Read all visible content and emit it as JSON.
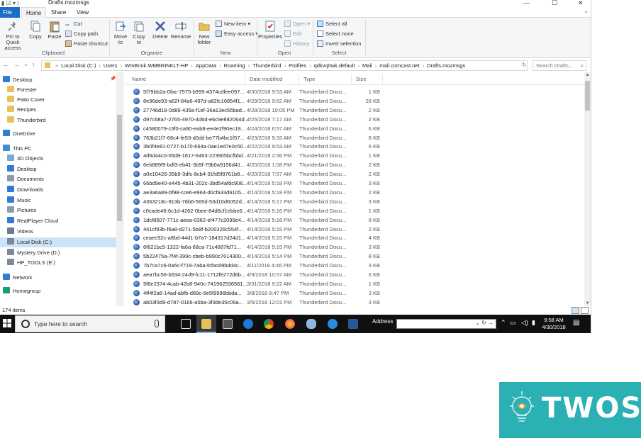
{
  "window": {
    "title": "Drafts.mozmsgs",
    "controls": [
      "—",
      "☐",
      "✕"
    ],
    "help_icon": "chevron-down-icon"
  },
  "ribbon": {
    "tabs": [
      "File",
      "Home",
      "Share",
      "View"
    ],
    "active_tab": "Home",
    "clipboard": {
      "pin": "Pin to Quick access",
      "copy": "Copy",
      "paste": "Paste",
      "cut": "Cut",
      "copy_path": "Copy path",
      "paste_shortcut": "Paste shortcut",
      "group": "Clipboard"
    },
    "organize": {
      "move_to": "Move to",
      "copy_to": "Copy to",
      "delete": "Delete",
      "rename": "Rename",
      "group": "Organize"
    },
    "new": {
      "new_folder": "New folder",
      "new_item": "New item",
      "easy_access": "Easy access",
      "group": "New"
    },
    "open": {
      "properties": "Properties",
      "open": "Open",
      "edit": "Edit",
      "history": "History",
      "group": "Open"
    },
    "select": {
      "select_all": "Select all",
      "select_none": "Select none",
      "invert": "Invert selection",
      "group": "Select"
    }
  },
  "address": {
    "back": "←",
    "forward": "→",
    "recent": "⌄",
    "up": "↑",
    "overflow": "«",
    "path": [
      "Local Disk (C:)",
      "Users",
      "WmBrink.WMBRINKLT-HP",
      "AppData",
      "Roaming",
      "Thunderbird",
      "Profiles",
      "qdkvq0wk.default",
      "Mail",
      "mail.comcast.net",
      "Drafts.mozmsgs"
    ],
    "search_placeholder": "Search Drafts..."
  },
  "nav_pane": [
    {
      "label": "Desktop",
      "icon": "desktop-icon",
      "color": "#2f7bd6"
    },
    {
      "label": "Forester",
      "icon": "folder-icon",
      "color": "#e8c15a"
    },
    {
      "label": "Patio Cover",
      "icon": "folder-icon",
      "color": "#e8c15a"
    },
    {
      "label": "Recipes",
      "icon": "folder-icon",
      "color": "#e8c15a"
    },
    {
      "label": "Thunderbird",
      "icon": "folder-icon",
      "color": "#e8c15a"
    },
    {
      "label": "OneDrive",
      "icon": "cloud-icon",
      "color": "#2f7bd6"
    },
    {
      "label": "This PC",
      "icon": "computer-icon",
      "color": "#3a8fd6"
    },
    {
      "label": "3D Objects",
      "icon": "cube-icon",
      "color": "#7aa7d9"
    },
    {
      "label": "Desktop",
      "icon": "desktop-icon",
      "color": "#2f7bd6"
    },
    {
      "label": "Documents",
      "icon": "documents-icon",
      "color": "#8a9bb0"
    },
    {
      "label": "Downloads",
      "icon": "download-icon",
      "color": "#2f7bd6"
    },
    {
      "label": "Music",
      "icon": "music-icon",
      "color": "#2f7bd6"
    },
    {
      "label": "Pictures",
      "icon": "pictures-icon",
      "color": "#8a9bb0"
    },
    {
      "label": "RealPlayer Cloud",
      "icon": "realplayer-icon",
      "color": "#2f7bd6"
    },
    {
      "label": "Videos",
      "icon": "videos-icon",
      "color": "#6b7c92"
    },
    {
      "label": "Local Disk (C:)",
      "icon": "disk-icon",
      "color": "#7a8899",
      "selected": true
    },
    {
      "label": "Mystery Drive (D:)",
      "icon": "disk-icon",
      "color": "#7a8899"
    },
    {
      "label": "HP_TOOLS (E:)",
      "icon": "disk-icon",
      "color": "#7a8899"
    },
    {
      "label": "Network",
      "icon": "network-icon",
      "color": "#2f7bd6"
    },
    {
      "label": "Homegroup",
      "icon": "homegroup-icon",
      "color": "#1c9b7a"
    }
  ],
  "columns": [
    "Name",
    "Date modified",
    "Type",
    "Size"
  ],
  "files": [
    {
      "name": "5f79bb2a-0fac-7575-b999-4374cdfee097...",
      "date": "4/30/2018 9:53 AM",
      "type": "Thunderbird Docu...",
      "size": "1 KB"
    },
    {
      "name": "8e96de93-a62f-84a6-497d-a82fc16854f1...",
      "date": "4/29/2018 9:52 AM",
      "type": "Thunderbird Docu...",
      "size": "28 KB"
    },
    {
      "name": "27746d18-0d89-435a-f1ef-36a13ec55bad...",
      "date": "4/28/2018 10:05 PM",
      "type": "Thunderbird Docu...",
      "size": "2 KB"
    },
    {
      "name": "d97c68a7-2765-4970-4d6d-e6c9e882064d...",
      "date": "4/25/2018 7:17 AM",
      "type": "Thunderbird Docu...",
      "size": "2 KB"
    },
    {
      "name": "c4580079-c3f0-ca90-eab8-ee4e2f90ec19...",
      "date": "4/24/2018 6:57 AM",
      "type": "Thunderbird Docu...",
      "size": "6 KB"
    },
    {
      "name": "763b21f7-66c4-fe53-d0dd-be77b4bc1f57...",
      "date": "4/23/2018 9:33 AM",
      "type": "Thunderbird Docu...",
      "size": "8 KB"
    },
    {
      "name": "3b0f4e81-0727-b170-664a-0ae1ed7e0c50...",
      "date": "4/22/2018 9:53 AM",
      "type": "Thunderbird Docu...",
      "size": "6 KB"
    },
    {
      "name": "4d6d44c0-05d8-1617-6463-223905bcfbbd...",
      "date": "4/21/2018 2:56 PM",
      "type": "Thunderbird Docu...",
      "size": "1 KB"
    },
    {
      "name": "6eb889f9-bdf3-eb41-3b9f-79b0a9156d41...",
      "date": "4/20/2018 1:08 PM",
      "type": "Thunderbird Docu...",
      "size": "2 KB"
    },
    {
      "name": "a0e10426-35b9-3dfc-8cb4-31fd5f8761b8...",
      "date": "4/20/2018 7:57 AM",
      "type": "Thunderbird Docu...",
      "size": "2 KB"
    },
    {
      "name": "66bd9e40-e445-4b31-202c-3bd54afdc906...",
      "date": "4/14/2018 5:18 PM",
      "type": "Thunderbird Docu...",
      "size": "3 KB"
    },
    {
      "name": "ae3a6a89-bf98-cce6-e964-d0cfa33d6105...",
      "date": "4/14/2018 5:18 PM",
      "type": "Thunderbird Docu...",
      "size": "2 KB"
    },
    {
      "name": "4363218c-913b-78b6-565d-53d10d6052d...",
      "date": "4/14/2018 5:17 PM",
      "type": "Thunderbird Docu...",
      "size": "3 KB"
    },
    {
      "name": "c0cade46-6c1d-4262-0bee-84d6cf1ebbe6...",
      "date": "4/14/2018 5:16 PM",
      "type": "Thunderbird Docu...",
      "size": "1 KB"
    },
    {
      "name": "1dcf8507-771c-aeea-0362-ef477c2099e4...",
      "date": "4/14/2018 5:16 PM",
      "type": "Thunderbird Docu...",
      "size": "8 KB"
    },
    {
      "name": "441cf93b-f6a8-d271-5b8f-b200326c554f...",
      "date": "4/14/2018 5:15 PM",
      "type": "Thunderbird Docu...",
      "size": "2 KB"
    },
    {
      "name": "ceaec92c-a8bd-44d1-b7a7-184317d24d1...",
      "date": "4/14/2018 5:15 PM",
      "type": "Thunderbird Docu...",
      "size": "4 KB"
    },
    {
      "name": "6f621bc5-1322-fa6a-68ca-71c4687fd71...",
      "date": "4/14/2018 5:15 PM",
      "type": "Thunderbird Docu...",
      "size": "3 KB"
    },
    {
      "name": "5b22475a-7f4f-399c-cbeb-b990c7614300...",
      "date": "4/14/2018 5:14 PM",
      "type": "Thunderbird Docu...",
      "size": "8 KB"
    },
    {
      "name": "7b7ca7c6-0a5c-f719-7aba-fcfac89bdd4c...",
      "date": "4/11/2018 4:46 PM",
      "type": "Thunderbird Docu...",
      "size": "3 KB"
    },
    {
      "name": "aea7bc56-b534-24d9-fc11-1712fe272d6b...",
      "date": "4/9/2018 10:57 AM",
      "type": "Thunderbird Docu...",
      "size": "6 KB"
    },
    {
      "name": "9f6e2374-4cab-42b8-940c-741962536561...",
      "date": "3/31/2018 9:22 AM",
      "type": "Thunderbird Docu...",
      "size": "1 KB"
    },
    {
      "name": "4ff4f2a6-14ad-abfb-d89c-6e5f9986bbda...",
      "date": "3/8/2018 8:47 PM",
      "type": "Thunderbird Docu...",
      "size": "3 KB"
    },
    {
      "name": "ab03f3d9-d787-0166-a5ba-3f3de35c09a...",
      "date": "3/5/2018 12:01 PM",
      "type": "Thunderbird Docu...",
      "size": "3 KB"
    }
  ],
  "status": {
    "items": "174 items"
  },
  "taskbar": {
    "search_placeholder": "Type here to search",
    "address_label": "Address",
    "time": "9:58 AM",
    "date": "4/30/2018"
  },
  "logo": {
    "text": "TWOS",
    "color": "#2bb0b4"
  }
}
